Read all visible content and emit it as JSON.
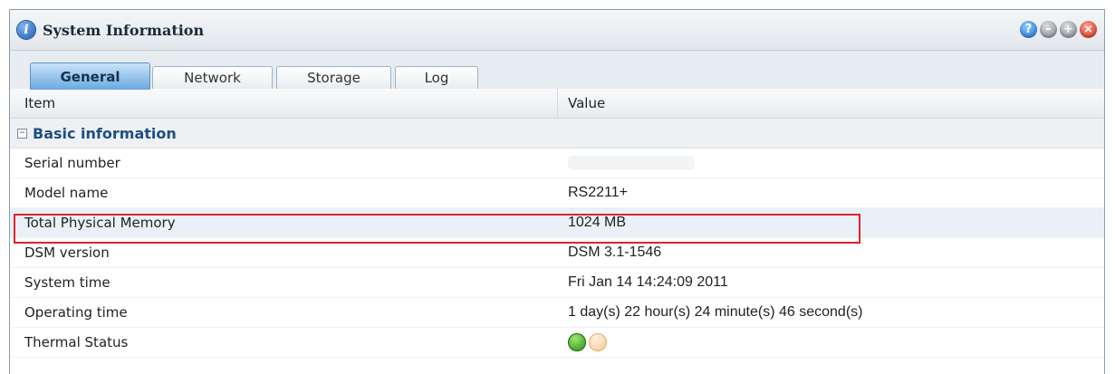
{
  "window": {
    "title": "System Information",
    "icon": "info-icon",
    "buttons": [
      "help-icon",
      "minimize-icon",
      "maximize-icon",
      "close-icon"
    ]
  },
  "tabs": [
    {
      "label": "General",
      "active": true
    },
    {
      "label": "Network",
      "active": false
    },
    {
      "label": "Storage",
      "active": false
    },
    {
      "label": "Log",
      "active": false
    }
  ],
  "table": {
    "columns": [
      "Item",
      "Value"
    ],
    "section": "Basic information",
    "rows": [
      {
        "item": "Serial number",
        "value": ""
      },
      {
        "item": "Model name",
        "value": "RS2211+"
      },
      {
        "item": "Total Physical Memory",
        "value": "1024 MB"
      },
      {
        "item": "DSM version",
        "value": "DSM 3.1-1546"
      },
      {
        "item": "System time",
        "value": "Fri Jan 14 14:24:09 2011"
      },
      {
        "item": "Operating time",
        "value": "1 day(s) 22 hour(s) 24 minute(s) 46 second(s)"
      },
      {
        "item": "Thermal Status",
        "value": ""
      }
    ]
  },
  "colors": {
    "highlight_box": "#e0232a",
    "section_text": "#1d4f80",
    "thermal_ok": "#2a9a1a",
    "thermal_warn": "#f3c48c"
  }
}
